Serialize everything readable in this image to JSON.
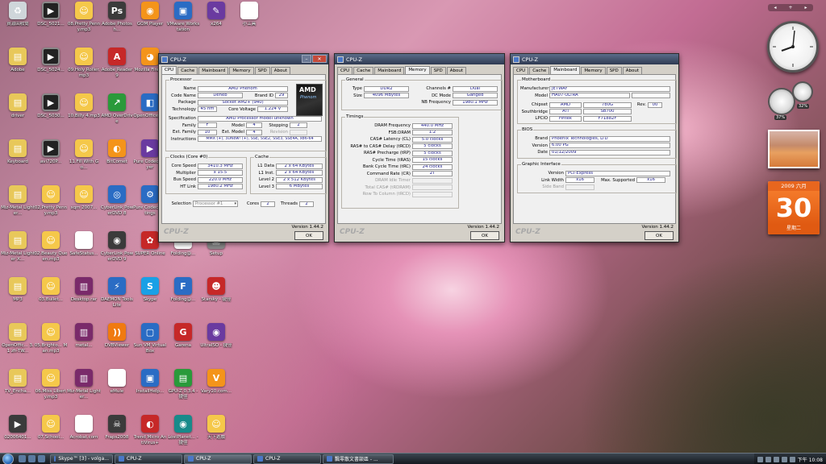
{
  "desktop_icons": [
    {
      "label": "資源回收筒",
      "glyph": "♻",
      "style": "g-recycle"
    },
    {
      "label": "DSC_5021...",
      "glyph": "▶",
      "style": "g-video"
    },
    {
      "label": "08.Pretty Penny.mp3",
      "glyph": "☺",
      "style": "g-face"
    },
    {
      "label": "Adobe Photosh...",
      "glyph": "Ps",
      "style": "g-dark"
    },
    {
      "label": "GOM Player",
      "glyph": "◉",
      "style": "g-orange"
    },
    {
      "label": "VMware Workstation",
      "glyph": "▣",
      "style": "g-blue"
    },
    {
      "label": "x264",
      "glyph": "✎",
      "style": "g-purple"
    },
    {
      "label": "小工具",
      "glyph": "✦",
      "style": "g-white"
    },
    {
      "label": "Adobe",
      "glyph": "▤",
      "style": "g-folder"
    },
    {
      "label": "DSC_5024...",
      "glyph": "▶",
      "style": "g-video"
    },
    {
      "label": "09.Holy Roller.mp3",
      "glyph": "☺",
      "style": "g-face"
    },
    {
      "label": "Adobe Reader 9",
      "glyph": "A",
      "style": "g-red"
    },
    {
      "label": "Mozilla Firefox",
      "glyph": "◕",
      "style": "g-orange"
    },
    {
      "label": "driver",
      "glyph": "▤",
      "style": "g-folder"
    },
    {
      "label": "DSC_5030...",
      "glyph": "▶",
      "style": "g-video"
    },
    {
      "label": "10.Billy 4.mp3",
      "glyph": "☺",
      "style": "g-face"
    },
    {
      "label": "AMD OverDrive",
      "glyph": "↗",
      "style": "g-green"
    },
    {
      "label": "OpenOffice 3.1",
      "glyph": "◧",
      "style": "g-blue"
    },
    {
      "label": "Keyboard",
      "glyph": "▤",
      "style": "g-folder"
    },
    {
      "label": "avi720P...",
      "glyph": "▶",
      "style": "g-video"
    },
    {
      "label": "11.Fill With Go...",
      "glyph": "☺",
      "style": "g-face"
    },
    {
      "label": "BitComet",
      "glyph": "◐",
      "style": "g-orange"
    },
    {
      "label": "Pure Codec Player",
      "glyph": "▶",
      "style": "g-purple"
    },
    {
      "label": "Miz-Metal Lighter...",
      "glyph": "▤",
      "style": "g-folder"
    },
    {
      "label": "02.Pretty Penny.mp3",
      "glyph": "☺",
      "style": "g-face"
    },
    {
      "label": "sqm 2007...",
      "glyph": "☺",
      "style": "g-face"
    },
    {
      "label": "CyberLink PowerDVD 8",
      "glyph": "◎",
      "style": "g-blue"
    },
    {
      "label": "Pure Codec Settings",
      "glyph": "⚙",
      "style": "g-blue"
    },
    {
      "label": "Miz-Metal Lighter X...",
      "glyph": "▤",
      "style": "g-folder"
    },
    {
      "label": "02.Beauty Queen.mp3",
      "glyph": "☺",
      "style": "g-face"
    },
    {
      "label": "SafeStatus...",
      "glyph": "⚙",
      "style": "g-white"
    },
    {
      "label": "CyberLink PowerDVD 9",
      "glyph": "◉",
      "style": "g-dark"
    },
    {
      "label": "SUPER Online",
      "glyph": "✿",
      "style": "g-red"
    },
    {
      "label": "Folding@...",
      "glyph": "✦",
      "style": "g-white"
    },
    {
      "label": "Setup",
      "glyph": "▣",
      "style": "g-gray"
    },
    {
      "label": "MP3",
      "glyph": "▤",
      "style": "g-folder"
    },
    {
      "label": "03.Bullet...",
      "glyph": "☺",
      "style": "g-face"
    },
    {
      "label": "Desktop.rar",
      "glyph": "▥",
      "style": "g-zip"
    },
    {
      "label": "DAEMON Tools Lite",
      "glyph": "⚡",
      "style": "g-blue"
    },
    {
      "label": "Skype",
      "glyph": "S",
      "style": "g-skype"
    },
    {
      "label": "Folding@...",
      "glyph": "F",
      "style": "g-blue"
    },
    {
      "label": "Starsky - 捷徑",
      "glyph": "☻",
      "style": "g-red"
    },
    {
      "label": "OpenOffic... 3.1 zh-TW...",
      "glyph": "▤",
      "style": "g-folder"
    },
    {
      "label": "05.Brighto... Man.mp3",
      "glyph": "☺",
      "style": "g-face"
    },
    {
      "label": "metal...",
      "glyph": "▥",
      "style": "g-zip"
    },
    {
      "label": "DVBViewer",
      "glyph": "))",
      "style": "g-rss"
    },
    {
      "label": "Sun VM VirtualBox",
      "glyph": "▢",
      "style": "g-blue"
    },
    {
      "label": "Garena",
      "glyph": "G",
      "style": "g-red"
    },
    {
      "label": "UltraISO - 捷徑",
      "glyph": "◉",
      "style": "g-purple"
    },
    {
      "label": "TV_Encha...",
      "glyph": "▤",
      "style": "g-folder"
    },
    {
      "label": "06.Miss Liberty.mp3",
      "glyph": "☺",
      "style": "g-face"
    },
    {
      "label": "Miz-Metal Lighter...",
      "glyph": "▥",
      "style": "g-zip"
    },
    {
      "label": "eMule",
      "glyph": "✶",
      "style": "g-white"
    },
    {
      "label": "InstallHelp...",
      "glyph": "▣",
      "style": "g-blue"
    },
    {
      "label": "GPU-Z 0.3.4 - 捷徑",
      "glyph": "▤",
      "style": "g-green"
    },
    {
      "label": "Vary10.com...",
      "glyph": "V",
      "style": "g-orange"
    },
    {
      "label": "02006401...",
      "glyph": "▶",
      "style": "g-dark"
    },
    {
      "label": "07.School...",
      "glyph": "☺",
      "style": "g-face"
    },
    {
      "label": "Acrobat.com",
      "glyph": "A",
      "style": "g-white"
    },
    {
      "label": "Fraps2008",
      "glyph": "☠",
      "style": "g-dark"
    },
    {
      "label": "Trend Micro AntiVirus+",
      "glyph": "◐",
      "style": "g-red"
    },
    {
      "label": "LostPlanet... - 捷徑",
      "glyph": "◉",
      "style": "g-teal"
    },
    {
      "label": "天下遊戲",
      "glyph": "☺",
      "style": "g-face"
    }
  ],
  "cpuz_cpu": {
    "title": "CPU-Z",
    "tabs": [
      "CPU",
      "Cache",
      "Mainboard",
      "Memory",
      "SPD",
      "About"
    ],
    "active_tab": "CPU",
    "processor_title": "Processor",
    "logo_text": "AMD",
    "logo_sub": "Phenom",
    "name_label": "Name",
    "name": "AMD Phenom",
    "codename_label": "Code Name",
    "codename": "Deneb",
    "brandid_label": "Brand ID",
    "brandid": "29",
    "package_label": "Package",
    "package": "Socket AM2+ (940)",
    "technology_label": "Technology",
    "technology": "45 nm",
    "corevoltage_label": "Core Voltage",
    "corevoltage": "1.224 V",
    "spec_label": "Specification",
    "spec": "AMD Processor model unknown",
    "family_label": "Family",
    "family": "F",
    "model_label": "Model",
    "model": "4",
    "stepping_label": "Stepping",
    "stepping": "2",
    "extfamily_label": "Ext. Family",
    "extfamily": "10",
    "extmodel_label": "Ext. Model",
    "extmodel": "4",
    "revision_label": "Revision",
    "revision": "",
    "instructions_label": "Instructions",
    "instructions": "MMX (+), 3DNow! (+), SSE, SSE2, SSE3, SSE4A, x86-64",
    "clocks_title": "Clocks (Core #0)",
    "corespeed_label": "Core Speed",
    "corespeed": "3410.3 MHz",
    "multiplier_label": "Multiplier",
    "multiplier": "x 15.5",
    "busspeed_label": "Bus Speed",
    "busspeed": "220.0 MHz",
    "htlink_label": "HT Link",
    "htlink": "1980.2 MHz",
    "cache_title": "Cache",
    "l1data_label": "L1 Data",
    "l1data": "2 x 64 KBytes",
    "l1inst_label": "L1 Inst.",
    "l1inst": "2 x 64 KBytes",
    "level2_label": "Level 2",
    "level2": "2 x 512 KBytes",
    "level3_label": "Level 3",
    "level3": "6 MBytes",
    "selection_label": "Selection",
    "selection": "Processor #1",
    "cores_label": "Cores",
    "cores": "2",
    "threads_label": "Threads",
    "threads": "2",
    "version": "Version 1.44.2",
    "brand": "CPU-Z",
    "ok_label": "OK"
  },
  "cpuz_memory": {
    "title": "CPU-Z",
    "tabs": [
      "CPU",
      "Cache",
      "Mainboard",
      "Memory",
      "SPD",
      "About"
    ],
    "active_tab": "Memory",
    "general_title": "General",
    "type_label": "Type",
    "type": "DDR2",
    "channels_label": "Channels #",
    "channels": "Dual",
    "size_label": "Size",
    "size": "4096 MBytes",
    "dcmode_label": "DC Mode",
    "dcmode": "Ganged",
    "nbfreq_label": "NB Frequency",
    "nbfreq": "1980.1 MHz",
    "timings_title": "Timings",
    "dramfreq_label": "DRAM Frequency",
    "dramfreq": "440.0 MHz",
    "fsbdram_label": "FSB:DRAM",
    "fsbdram": "1:2",
    "cl_label": "CAS# Latency (CL)",
    "cl": "5.0 clocks",
    "trcd_label": "RAS# to CAS# Delay (tRCD)",
    "trcd": "5 clocks",
    "trp_label": "RAS# Precharge (tRP)",
    "trp": "5 clocks",
    "tras_label": "Cycle Time (tRAS)",
    "tras": "15 clocks",
    "trc_label": "Bank Cycle Time (tRC)",
    "trc": "24 clocks",
    "cr_label": "Command Rate (CR)",
    "cr": "2T",
    "idle_label": "DRAM Idle Timer",
    "trdram_label": "Total CAS# (tRDRAM)",
    "trcd2_label": "Row To Column (tRCD)",
    "version": "Version 1.44.2",
    "brand": "CPU-Z",
    "ok_label": "OK"
  },
  "cpuz_mainboard": {
    "title": "CPU-Z",
    "tabs": [
      "CPU",
      "Cache",
      "Mainboard",
      "Memory",
      "SPD",
      "About"
    ],
    "active_tab": "Mainboard",
    "mb_title": "Motherboard",
    "manufacturer_label": "Manufacturer",
    "manufacturer": "JETWAY",
    "model_label": "Model",
    "model": "HA07-ULTRA",
    "chipset_label": "Chipset",
    "chipset_vendor": "AMD",
    "chipset": "780G",
    "rev_label": "Rev.",
    "rev": "00",
    "southbridge_label": "Southbridge",
    "sb_vendor": "ATI",
    "southbridge": "SB700",
    "lpcio_label": "LPCIO",
    "lpcio_vendor": "Fintek",
    "lpcio": "F71882F",
    "bios_title": "BIOS",
    "brand_label": "Brand",
    "bios_brand": "Phoenix Technologies, LTD",
    "version_label": "Version",
    "bios_version": "6.00 PG",
    "date_label": "Date",
    "bios_date": "01/12/2009",
    "gi_title": "Graphic Interface",
    "giversion_label": "Version",
    "giversion": "PCI-Express",
    "linkwidth_label": "Link Width",
    "linkwidth": "x16",
    "maxsupported_label": "Max. Supported",
    "maxsupported": "x16",
    "sideband_label": "Side Band",
    "version": "Version 1.44.2",
    "brand": "CPU-Z",
    "ok_label": "OK"
  },
  "calendar": {
    "year_month": "2009 六月",
    "day": "30",
    "weekday": "星期二"
  },
  "meter": {
    "cpu": "37%",
    "mem": "32%"
  },
  "taskbar": {
    "tasks": [
      {
        "label": "Skype™ [3] - volga...",
        "active": false
      },
      {
        "label": "CPU-Z",
        "active": false
      },
      {
        "label": "CPU-Z",
        "active": true
      },
      {
        "label": "CPU-Z",
        "active": false
      },
      {
        "label": "飄零散文書談區 - ...",
        "active": false
      }
    ],
    "clock": "下午 10:08"
  }
}
